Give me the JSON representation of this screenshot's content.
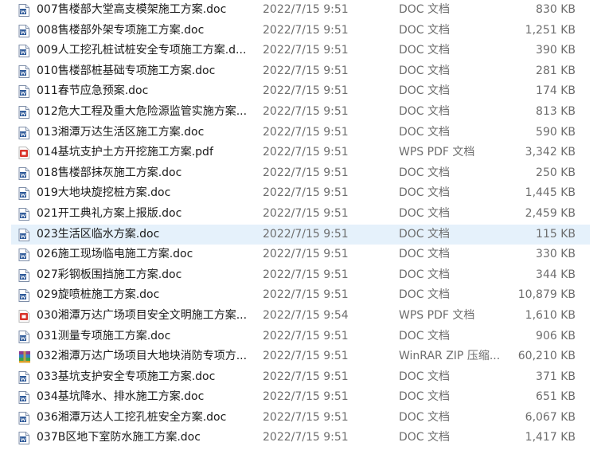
{
  "files": [
    {
      "name": "007售楼部大堂高支模架施工方案.doc",
      "date": "2022/7/15 9:51",
      "type": "DOC 文档",
      "size": "830 KB",
      "icon": "word-doc-icon"
    },
    {
      "name": "008售楼部外架专项施工方案.doc",
      "date": "2022/7/15 9:51",
      "type": "DOC 文档",
      "size": "1,251 KB",
      "icon": "word-doc-icon"
    },
    {
      "name": "009人工挖孔桩试桩安全专项施工方案.d...",
      "date": "2022/7/15 9:51",
      "type": "DOC 文档",
      "size": "390 KB",
      "icon": "word-doc-icon"
    },
    {
      "name": "010售楼部桩基础专项施工方案.doc",
      "date": "2022/7/15 9:51",
      "type": "DOC 文档",
      "size": "281 KB",
      "icon": "word-doc-icon"
    },
    {
      "name": "011春节应急预案.doc",
      "date": "2022/7/15 9:51",
      "type": "DOC 文档",
      "size": "174 KB",
      "icon": "word-doc-icon"
    },
    {
      "name": "012危大工程及重大危险源监管实施方案...",
      "date": "2022/7/15 9:51",
      "type": "DOC 文档",
      "size": "813 KB",
      "icon": "word-doc-icon"
    },
    {
      "name": "013湘潭万达生活区施工方案.doc",
      "date": "2022/7/15 9:51",
      "type": "DOC 文档",
      "size": "590 KB",
      "icon": "word-doc-icon"
    },
    {
      "name": "014基坑支护土方开挖施工方案.pdf",
      "date": "2022/7/15 9:51",
      "type": "WPS PDF 文档",
      "size": "3,342 KB",
      "icon": "pdf-icon"
    },
    {
      "name": "018售楼部抹灰施工方案.doc",
      "date": "2022/7/15 9:51",
      "type": "DOC 文档",
      "size": "250 KB",
      "icon": "word-doc-icon"
    },
    {
      "name": "019大地块旋挖桩方案.doc",
      "date": "2022/7/15 9:51",
      "type": "DOC 文档",
      "size": "1,445 KB",
      "icon": "word-doc-icon"
    },
    {
      "name": "021开工典礼方案上报版.doc",
      "date": "2022/7/15 9:51",
      "type": "DOC 文档",
      "size": "2,459 KB",
      "icon": "word-doc-icon"
    },
    {
      "name": "023生活区临水方案.doc",
      "date": "2022/7/15 9:51",
      "type": "DOC 文档",
      "size": "115 KB",
      "icon": "word-doc-icon",
      "selected": true
    },
    {
      "name": "026施工现场临电施工方案.doc",
      "date": "2022/7/15 9:51",
      "type": "DOC 文档",
      "size": "330 KB",
      "icon": "word-doc-icon"
    },
    {
      "name": "027彩钢板围挡施工方案.doc",
      "date": "2022/7/15 9:51",
      "type": "DOC 文档",
      "size": "344 KB",
      "icon": "word-doc-icon"
    },
    {
      "name": "029旋喷桩施工方案.doc",
      "date": "2022/7/15 9:51",
      "type": "DOC 文档",
      "size": "10,879 KB",
      "icon": "word-doc-icon"
    },
    {
      "name": "030湘潭万达广场项目安全文明施工方案...",
      "date": "2022/7/15 9:54",
      "type": "WPS PDF 文档",
      "size": "1,610 KB",
      "icon": "pdf-icon"
    },
    {
      "name": "031测量专项施工方案.doc",
      "date": "2022/7/15 9:51",
      "type": "DOC 文档",
      "size": "906 KB",
      "icon": "word-doc-icon"
    },
    {
      "name": "032湘潭万达广场项目大地块消防专项方...",
      "date": "2022/7/15 9:51",
      "type": "WinRAR ZIP 压缩...",
      "size": "60,210 KB",
      "icon": "winrar-archive-icon"
    },
    {
      "name": "033基坑支护安全专项施工方案.doc",
      "date": "2022/7/15 9:51",
      "type": "DOC 文档",
      "size": "371 KB",
      "icon": "word-doc-icon"
    },
    {
      "name": "034基坑降水、排水施工方案.doc",
      "date": "2022/7/15 9:51",
      "type": "DOC 文档",
      "size": "651 KB",
      "icon": "word-doc-icon"
    },
    {
      "name": "036湘潭万达人工挖孔桩安全方案.doc",
      "date": "2022/7/15 9:51",
      "type": "DOC 文档",
      "size": "6,067 KB",
      "icon": "word-doc-icon"
    },
    {
      "name": "037B区地下室防水施工方案.doc",
      "date": "2022/7/15 9:51",
      "type": "DOC 文档",
      "size": "1,417 KB",
      "icon": "word-doc-icon"
    }
  ],
  "colors": {
    "selected_row": "#e5f1fb",
    "word_icon": "#2b5797",
    "pdf_icon": "#d9342b"
  }
}
